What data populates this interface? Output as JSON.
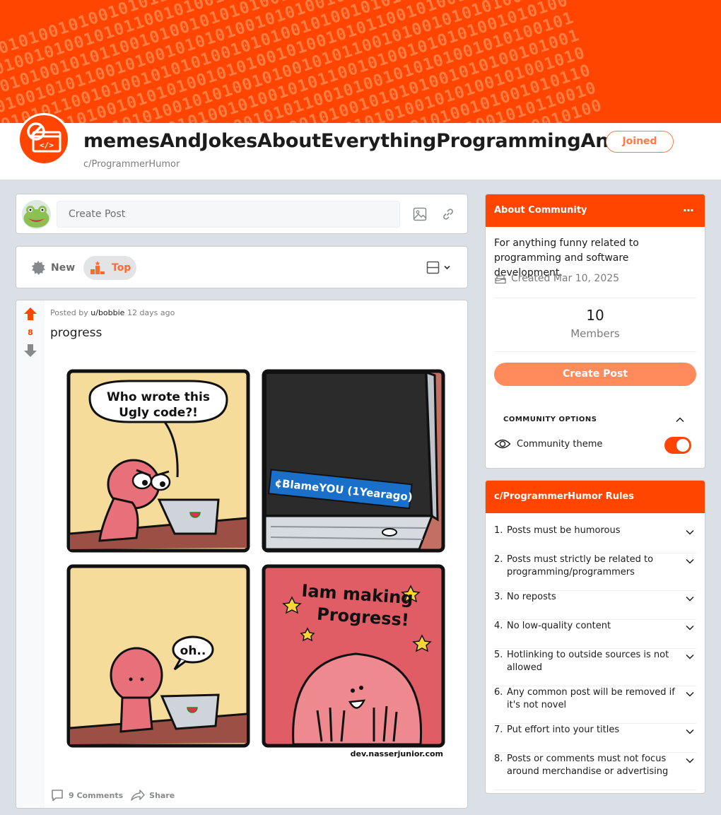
{
  "banner": {
    "pattern_text": "0101001010100101001010110010100101"
  },
  "header": {
    "community_name": "memesAndJokesAboutEverythingProgrammingAndCS",
    "community_slug": "c/ProgrammerHumor",
    "joined_label": "Joined"
  },
  "create_bar": {
    "placeholder": "Create Post"
  },
  "sort": {
    "new_label": "New",
    "top_label": "Top"
  },
  "post": {
    "posted_by_prefix": "Posted by",
    "author": "u/bobbie",
    "age": "12 days ago",
    "votes": "8",
    "title": "progress",
    "comic": {
      "panel1_speech_line1": "Who wrote this",
      "panel1_speech_line2": "Ugly code?!",
      "panel2_screen_text": "¢BlameYOU (1Yearago)",
      "panel3_speech": "oh..",
      "panel4_line1": "Iam making",
      "panel4_line2": "Progress!",
      "credit": "dev.nasserjunior.com"
    },
    "comments_label": "9 Comments",
    "share_label": "Share"
  },
  "about": {
    "title": "About Community",
    "more_icon": "···",
    "description": "For anything funny related to programming and software development.",
    "created": "Created Mar 10, 2025",
    "members_count": "10",
    "members_label": "Members",
    "create_post_label": "Create Post",
    "options_title": "COMMUNITY OPTIONS",
    "theme_label": "Community theme",
    "theme_on": true
  },
  "rules": {
    "title": "c/ProgrammerHumor Rules",
    "items": [
      {
        "num": "1.",
        "text": "Posts must be humorous"
      },
      {
        "num": "2.",
        "text": "Posts must strictly be related to programming/programmers"
      },
      {
        "num": "3.",
        "text": "No reposts"
      },
      {
        "num": "4.",
        "text": "No low-quality content"
      },
      {
        "num": "5.",
        "text": "Hotlinking to outside sources is not allowed"
      },
      {
        "num": "6.",
        "text": "Any common post will be removed if it's not novel"
      },
      {
        "num": "7.",
        "text": "Put effort into your titles"
      },
      {
        "num": "8.",
        "text": "Posts or comments must not focus around merchandise or advertising"
      }
    ]
  },
  "colors": {
    "brand": "#ff4500",
    "accent_soft": "#ff8a5b",
    "page_bg": "#dae0e6"
  },
  "icons": [
    "community-logo-icon",
    "image-icon",
    "link-icon",
    "new-sort-icon",
    "top-sort-icon",
    "layout-icon",
    "chevron-down-icon",
    "upvote-icon",
    "downvote-icon",
    "comment-icon",
    "share-icon",
    "more-icon",
    "cake-icon",
    "chevron-up-icon",
    "eye-icon"
  ]
}
